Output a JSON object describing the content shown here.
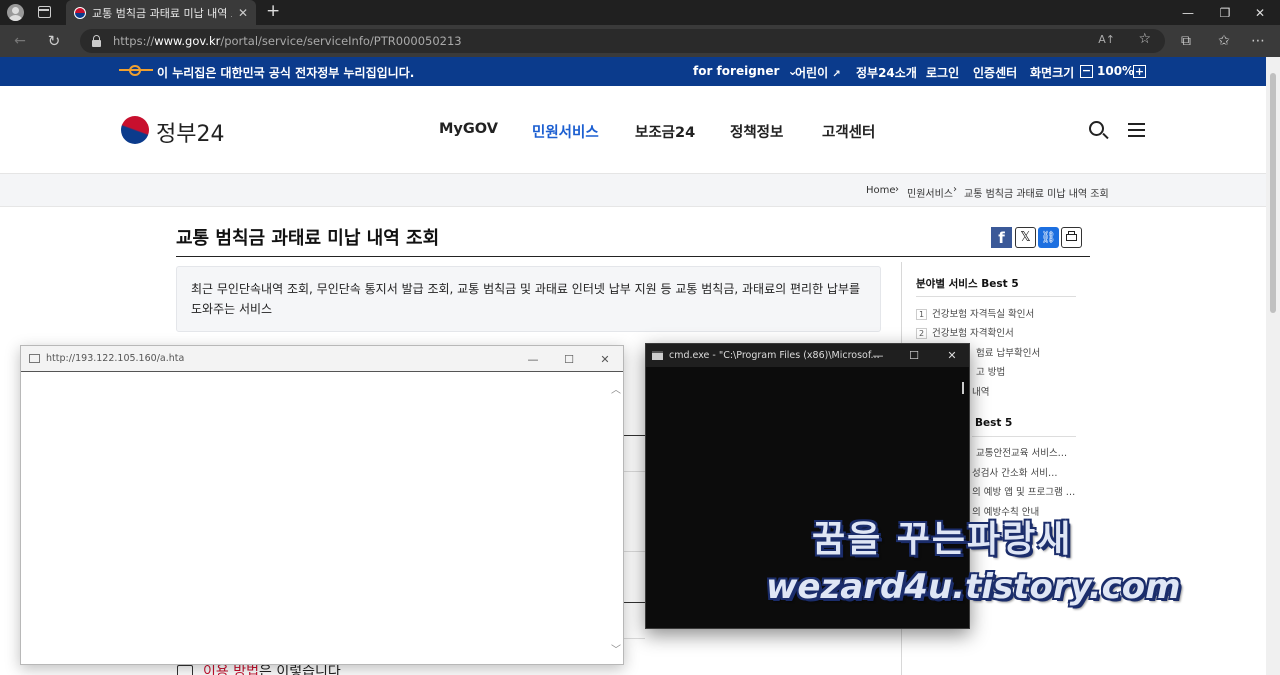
{
  "browser": {
    "tab_title": "교통 범칙금 과태료 미납 내역 조회",
    "url_prefix": "https://",
    "url_host": "www.gov.kr",
    "url_path": "/portal/service/serviceInfo/PTR000050213",
    "read_aloud": "A↑"
  },
  "notice": {
    "text": "이 누리집은 대한민국 공식 전자정부 누리집입니다.",
    "foreigner": "for foreigner",
    "kids": "어린이",
    "intro": "정부24소개",
    "login": "로그인",
    "cert": "인증센터",
    "zoom_label": "화면크기",
    "zoom_value": "100%"
  },
  "header": {
    "logo": "정부24",
    "menu": [
      "MyGOV",
      "민원서비스",
      "보조금24",
      "정책정보",
      "고객센터"
    ]
  },
  "breadcrumb": [
    "Home",
    "민원서비스",
    "교통 범칙금 과태료 미납 내역 조회"
  ],
  "page": {
    "title": "교통 범칙금 과태료 미납 내역 조회",
    "summary": "최근 무인단속내역 조회, 무인단속 통지서 발급 조회, 교통 범칙금 및 과태료 인터넷 납부 지원 등 교통 범칙금, 과태료의 편리한 납부를 도와주는 서비스",
    "usage_link": "이용 방법",
    "usage_rest": "은 이렇습니다"
  },
  "sidebar": {
    "section1_title": "분야별 서비스 Best 5",
    "section1_items": [
      "건강보험 자격득실 확인서",
      "건강보험 자격확인서",
      "험료 납부확인서",
      "고 방법",
      "내역"
    ],
    "section2_title": "Best 5",
    "section2_items": [
      "교통안전교육 서비스…",
      "성검사 간소화 서비…",
      "의 예방 앱 및 프로그램 …",
      "의 예방수칙 안내"
    ]
  },
  "hta_window": {
    "title": "http://193.122.105.160/a.hta"
  },
  "cmd_window": {
    "title": "cmd.exe - \"C:\\Program Files (x86)\\Microsof..."
  },
  "watermark": {
    "line1": "꿈을 꾸는파랑새",
    "line2": "wezard4u.tistory.com"
  },
  "colors": {
    "gov_blue": "#0b3b8c",
    "active_menu": "#1c5fd1",
    "accent_red": "#c8102e"
  }
}
